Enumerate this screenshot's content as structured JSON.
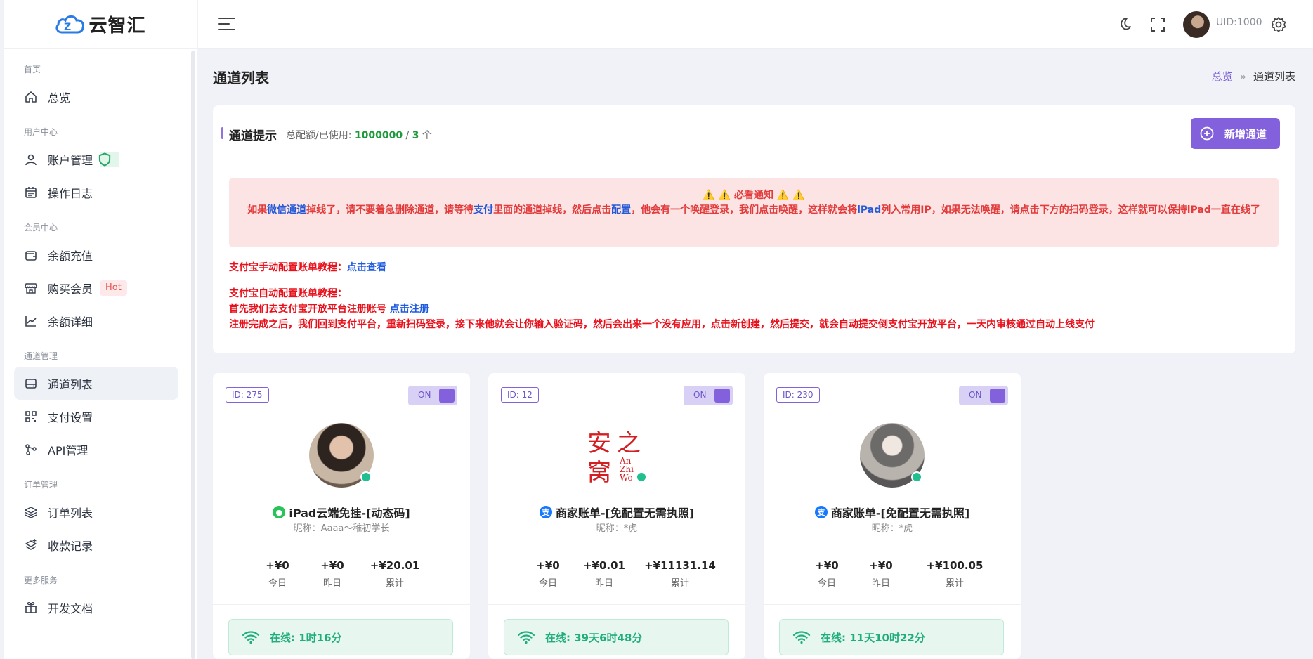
{
  "app": {
    "logo_text": "云智汇"
  },
  "header": {
    "uid": "UID:1000"
  },
  "sidebar": {
    "sections": [
      {
        "title": "首页",
        "items": [
          {
            "label": "总览",
            "icon": "home-icon"
          }
        ]
      },
      {
        "title": "用户中心",
        "items": [
          {
            "label": "账户管理",
            "icon": "user-icon",
            "badge": "shield"
          },
          {
            "label": "操作日志",
            "icon": "calendar-icon"
          }
        ]
      },
      {
        "title": "会员中心",
        "items": [
          {
            "label": "余额充值",
            "icon": "wallet-icon"
          },
          {
            "label": "购买会员",
            "icon": "store-icon",
            "badge": "Hot"
          },
          {
            "label": "余额详细",
            "icon": "chart-line-icon"
          }
        ]
      },
      {
        "title": "通道管理",
        "items": [
          {
            "label": "通道列表",
            "icon": "drive-icon",
            "active": true
          },
          {
            "label": "支付设置",
            "icon": "qr-icon"
          },
          {
            "label": "API管理",
            "icon": "api-icon"
          }
        ]
      },
      {
        "title": "订单管理",
        "items": [
          {
            "label": "订单列表",
            "icon": "layers-icon"
          },
          {
            "label": "收款记录",
            "icon": "layers-plus-icon"
          }
        ]
      },
      {
        "title": "更多服务",
        "items": [
          {
            "label": "开发文档",
            "icon": "gift-icon"
          }
        ]
      }
    ]
  },
  "page": {
    "title": "通道列表",
    "breadcrumb": {
      "root": "总览",
      "sep": "»",
      "current": "通道列表"
    }
  },
  "notice": {
    "title": "通道提示",
    "quota_label": "总配额/已使用:",
    "quota_total": "1000000",
    "quota_sep": "/",
    "quota_used": "3",
    "quota_unit": "个",
    "add_button": "新增通道",
    "alert_title": "⚠️ ⚠️ 必看通知 ⚠️ ⚠️",
    "alert_p1": "如果",
    "alert_b1": "微信通道",
    "alert_p2": "掉线了，请不要着急删除通道，请等待",
    "alert_b2": "支付",
    "alert_p3": "里面的通道掉线，然后点击",
    "alert_b3": "配置",
    "alert_p4": "，他会有一个唤醒登录，我们点击唤醒，这样就会将",
    "alert_b4": "iPad",
    "alert_p5": "列入常用IP，如果无法唤醒，请点击下方的扫码登录，这样就可以保持iPad一直在线了",
    "manual_label": "支付宝手动配置账单教程：",
    "manual_link": "点击查看",
    "auto_label": "支付宝自动配置账单教程：",
    "auto_line1": "首先我们去支付宝开放平台注册账号",
    "auto_link": "点击注册",
    "auto_line2": "注册完成之后，我们回到支付平台，重新扫码登录，接下来他就会让你输入验证码，然后会出来一个没有应用，点击新创建，然后提交，就会自动提交倒支付宝开放平台，一天内审核通过自动上线支付"
  },
  "cards": [
    {
      "id": "ID: 275",
      "switch": "ON",
      "name": "iPad云端免挂-[动态码]",
      "brand": "wechat",
      "nick": "昵称：Aaaa～稚初学长",
      "today": "+¥0",
      "yesterday": "+¥0",
      "total": "+¥20.01",
      "today_k": "今日",
      "yesterday_k": "昨日",
      "total_k": "累计",
      "online": "在线: 1时16分"
    },
    {
      "id": "ID: 12",
      "switch": "ON",
      "name": "商家账单-[免配置无需执照]",
      "brand": "alipay",
      "nick": "昵称：*虎",
      "today": "+¥0",
      "yesterday": "+¥0.01",
      "total": "+¥11131.14",
      "today_k": "今日",
      "yesterday_k": "昨日",
      "total_k": "累计",
      "online": "在线: 39天6时48分",
      "seal": {
        "big1": "安",
        "big2": "之",
        "big3": "窝",
        "small1": "An",
        "small2": "Zhi",
        "small3": "Wo"
      }
    },
    {
      "id": "ID: 230",
      "switch": "ON",
      "name": "商家账单-[免配置无需执照]",
      "brand": "alipay",
      "nick": "昵称：*虎",
      "today": "+¥0",
      "yesterday": "+¥0",
      "total": "+¥100.05",
      "today_k": "今日",
      "yesterday_k": "昨日",
      "total_k": "累计",
      "online": "在线: 11天10时22分"
    }
  ],
  "colors": {
    "accent": "#8461dc",
    "online": "#1fae7a",
    "alert_text": "#e23b3b",
    "alert_bg": "#fde4e4",
    "link_blue": "#1e5be0"
  }
}
